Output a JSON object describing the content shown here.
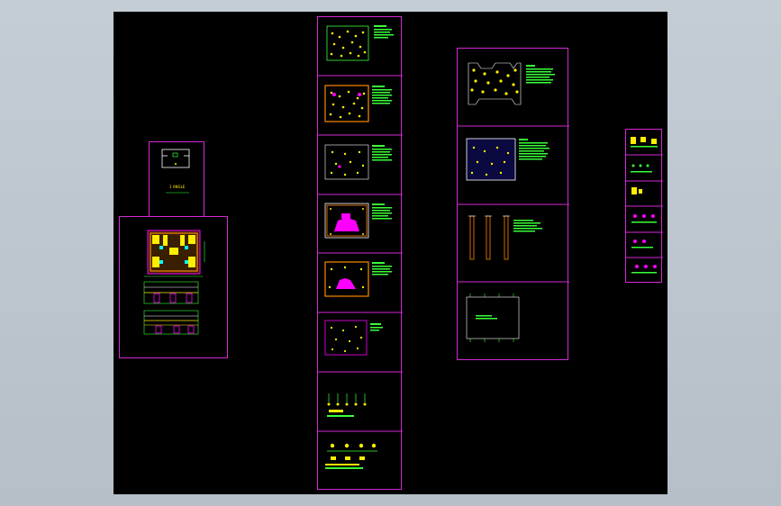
{
  "viewport": {
    "background_color": "#000000",
    "frame_color": "#d428d4",
    "accent_colors": [
      "#ffee00",
      "#39ff39",
      "#ff00ff",
      "#00ffff",
      "#ff8800",
      "#ffffff"
    ]
  },
  "drawing": {
    "small_label": "1 ANGLE"
  },
  "sheets": {
    "left_column": [
      "title-block",
      "layout-plan"
    ],
    "center_column": [
      "ceiling-plan-1",
      "ceiling-plan-2",
      "ceiling-plan-3",
      "ceiling-plan-4",
      "ceiling-plan-5",
      "ceiling-plan-6",
      "fixture-legend-1",
      "fixture-legend-2"
    ],
    "right_column": [
      "detail-plan-1",
      "detail-plan-2",
      "section-elevations",
      "frame-plan"
    ],
    "far_right_column": [
      "icon-sheet-1",
      "icon-sheet-2",
      "icon-sheet-3",
      "icon-sheet-4",
      "icon-sheet-5",
      "icon-sheet-6"
    ]
  }
}
